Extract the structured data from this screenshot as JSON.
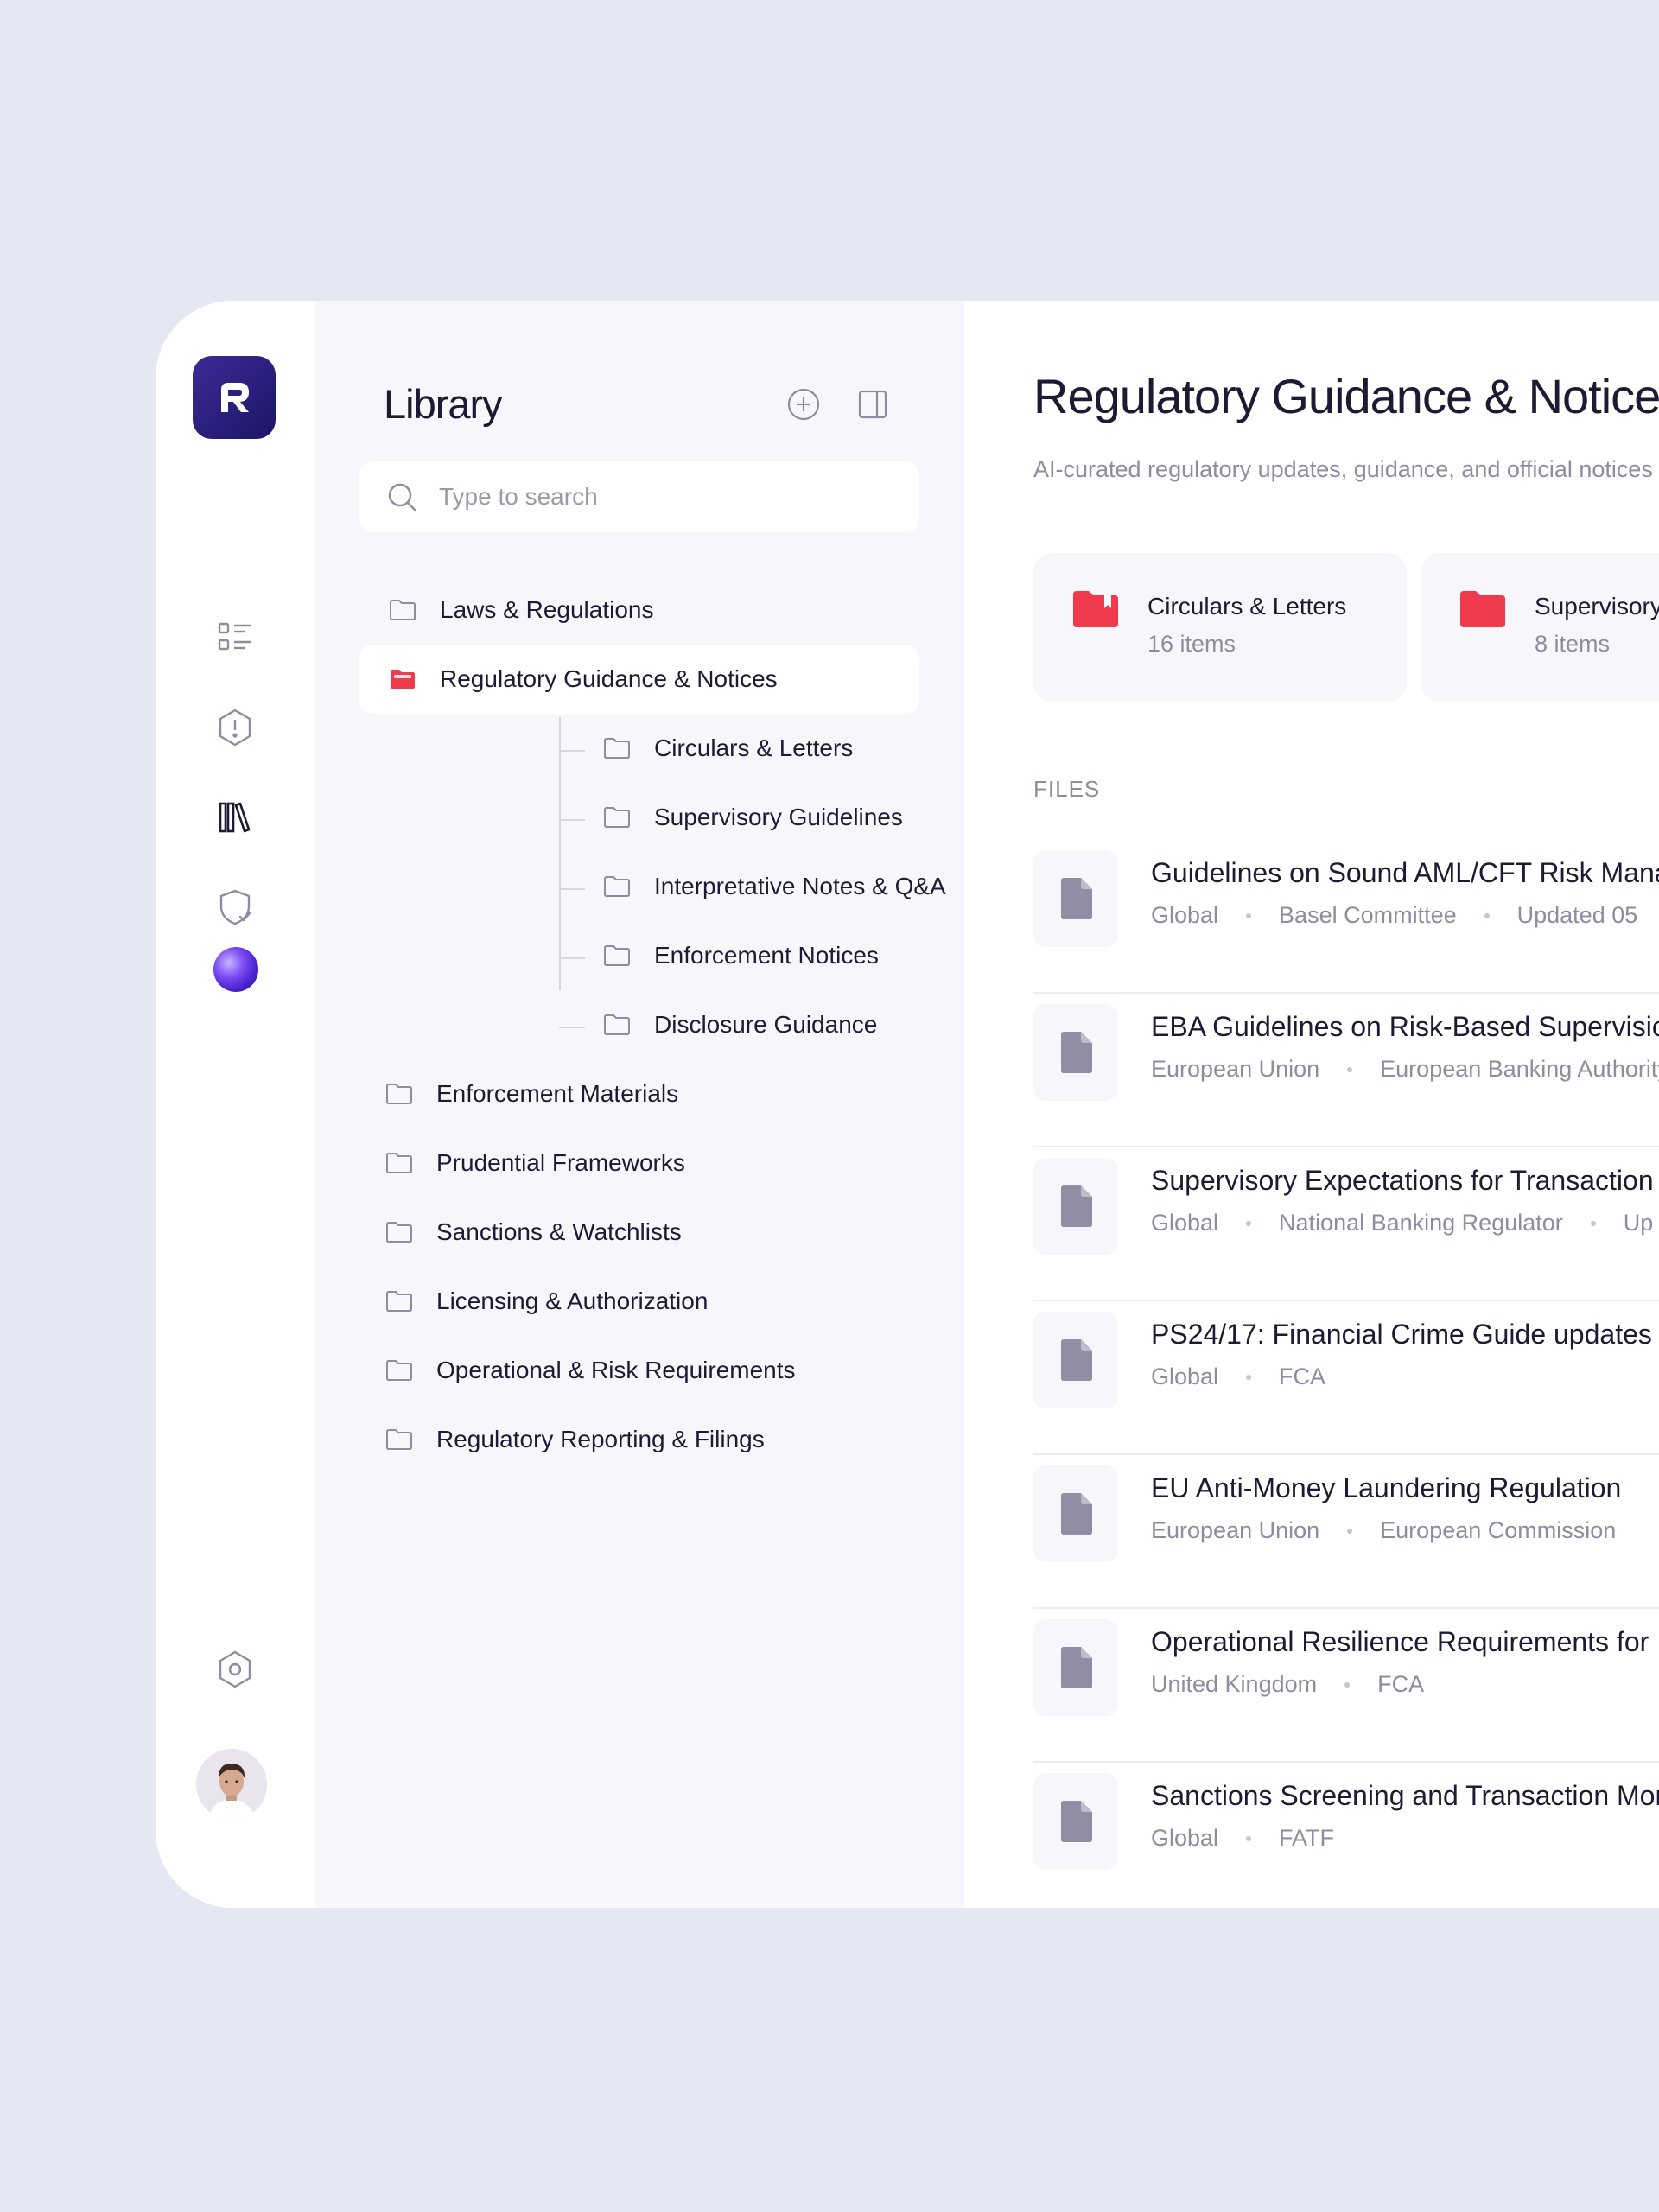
{
  "library": {
    "title": "Library",
    "search_placeholder": "Type to search",
    "items": [
      {
        "label": "Laws & Regulations",
        "level": 0
      },
      {
        "label": "Regulatory Guidance & Notices",
        "level": 0,
        "active": true
      },
      {
        "label": "Circulars & Letters",
        "level": 1
      },
      {
        "label": "Supervisory Guidelines",
        "level": 1
      },
      {
        "label": "Interpretative Notes & Q&A",
        "level": 1
      },
      {
        "label": "Enforcement Notices",
        "level": 1
      },
      {
        "label": "Disclosure Guidance",
        "level": 1
      },
      {
        "label": "Enforcement Materials",
        "level": 0
      },
      {
        "label": "Prudential Frameworks",
        "level": 0
      },
      {
        "label": "Sanctions & Watchlists",
        "level": 0
      },
      {
        "label": "Licensing & Authorization",
        "level": 0
      },
      {
        "label": "Operational & Risk Requirements",
        "level": 0
      },
      {
        "label": "Regulatory Reporting & Filings",
        "level": 0
      }
    ]
  },
  "main": {
    "title": "Regulatory Guidance & Notices",
    "subtitle": "AI-curated regulatory updates, guidance, and official notices",
    "folders": [
      {
        "name": "Circulars & Letters",
        "count": "16 items"
      },
      {
        "name": "Supervisory Guidelines",
        "count": "8 items"
      }
    ],
    "files_label": "FILES",
    "files": [
      {
        "title": "Guidelines on Sound AML/CFT Risk Management",
        "meta": [
          "Global",
          "Basel Committee",
          "Updated 05"
        ]
      },
      {
        "title": "EBA Guidelines on Risk-Based Supervision",
        "meta": [
          "European Union",
          "European Banking Authority"
        ]
      },
      {
        "title": "Supervisory Expectations for Transaction Monitoring",
        "meta": [
          "Global",
          "National Banking Regulator",
          "Up"
        ]
      },
      {
        "title": "PS24/17: Financial Crime Guide updates",
        "meta": [
          "Global",
          "FCA"
        ]
      },
      {
        "title": "EU Anti-Money Laundering Regulation",
        "meta": [
          "European Union",
          "European Commission"
        ]
      },
      {
        "title": "Operational Resilience Requirements for",
        "meta": [
          "United Kingdom",
          "FCA"
        ]
      },
      {
        "title": "Sanctions Screening and Transaction Monitoring",
        "meta": [
          "Global",
          "FATF"
        ]
      }
    ]
  },
  "colors": {
    "accent": "#ef3b4d",
    "brand": "#2a1f7a",
    "background": "#e5e8f3"
  },
  "icons": {
    "rail": [
      "list-icon",
      "alert-hexagon-icon",
      "library-books-icon",
      "shield-check-icon",
      "ai-orb-icon",
      "settings-hexagon-icon"
    ]
  }
}
